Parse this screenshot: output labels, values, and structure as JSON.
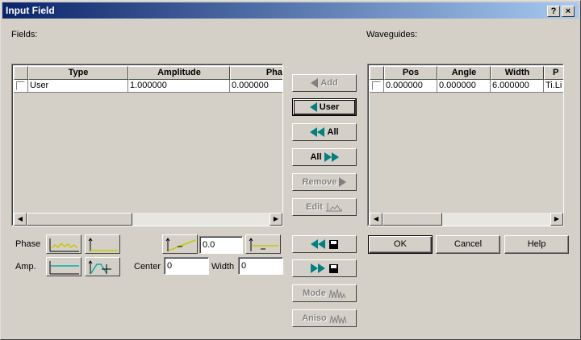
{
  "window": {
    "title": "Input Field",
    "help_btn": "?",
    "close_btn": "×"
  },
  "labels": {
    "fields": "Fields:",
    "waveguides": "Waveguides:",
    "phase": "Phase",
    "amp": "Amp.",
    "center": "Center",
    "width": "Width"
  },
  "fields_table": {
    "columns": [
      "Type",
      "Amplitude",
      "Pha"
    ],
    "rows": [
      {
        "type": "User",
        "amplitude": "1.000000",
        "phase": "0.000000"
      }
    ]
  },
  "waveguides_table": {
    "columns": [
      "Pos",
      "Angle",
      "Width",
      "P"
    ],
    "rows": [
      {
        "pos": "0.000000",
        "angle": "0.000000",
        "width": "6.000000",
        "p": "Ti.Li"
      }
    ]
  },
  "middle_buttons": {
    "add": "Add",
    "user": "User",
    "all_left": "All",
    "all_right": "All",
    "remove": "Remove",
    "edit": "Edit",
    "mode": "Mode",
    "aniso": "Aniso"
  },
  "inputs": {
    "phase_value": "0.0",
    "center_value": "0",
    "width_value": "0"
  },
  "dialog_buttons": {
    "ok": "OK",
    "cancel": "Cancel",
    "help": "Help"
  },
  "colors": {
    "title_start": "#0a246a",
    "title_end": "#a6caf0",
    "accent_teal": "#008080",
    "face": "#d4d0c8"
  }
}
